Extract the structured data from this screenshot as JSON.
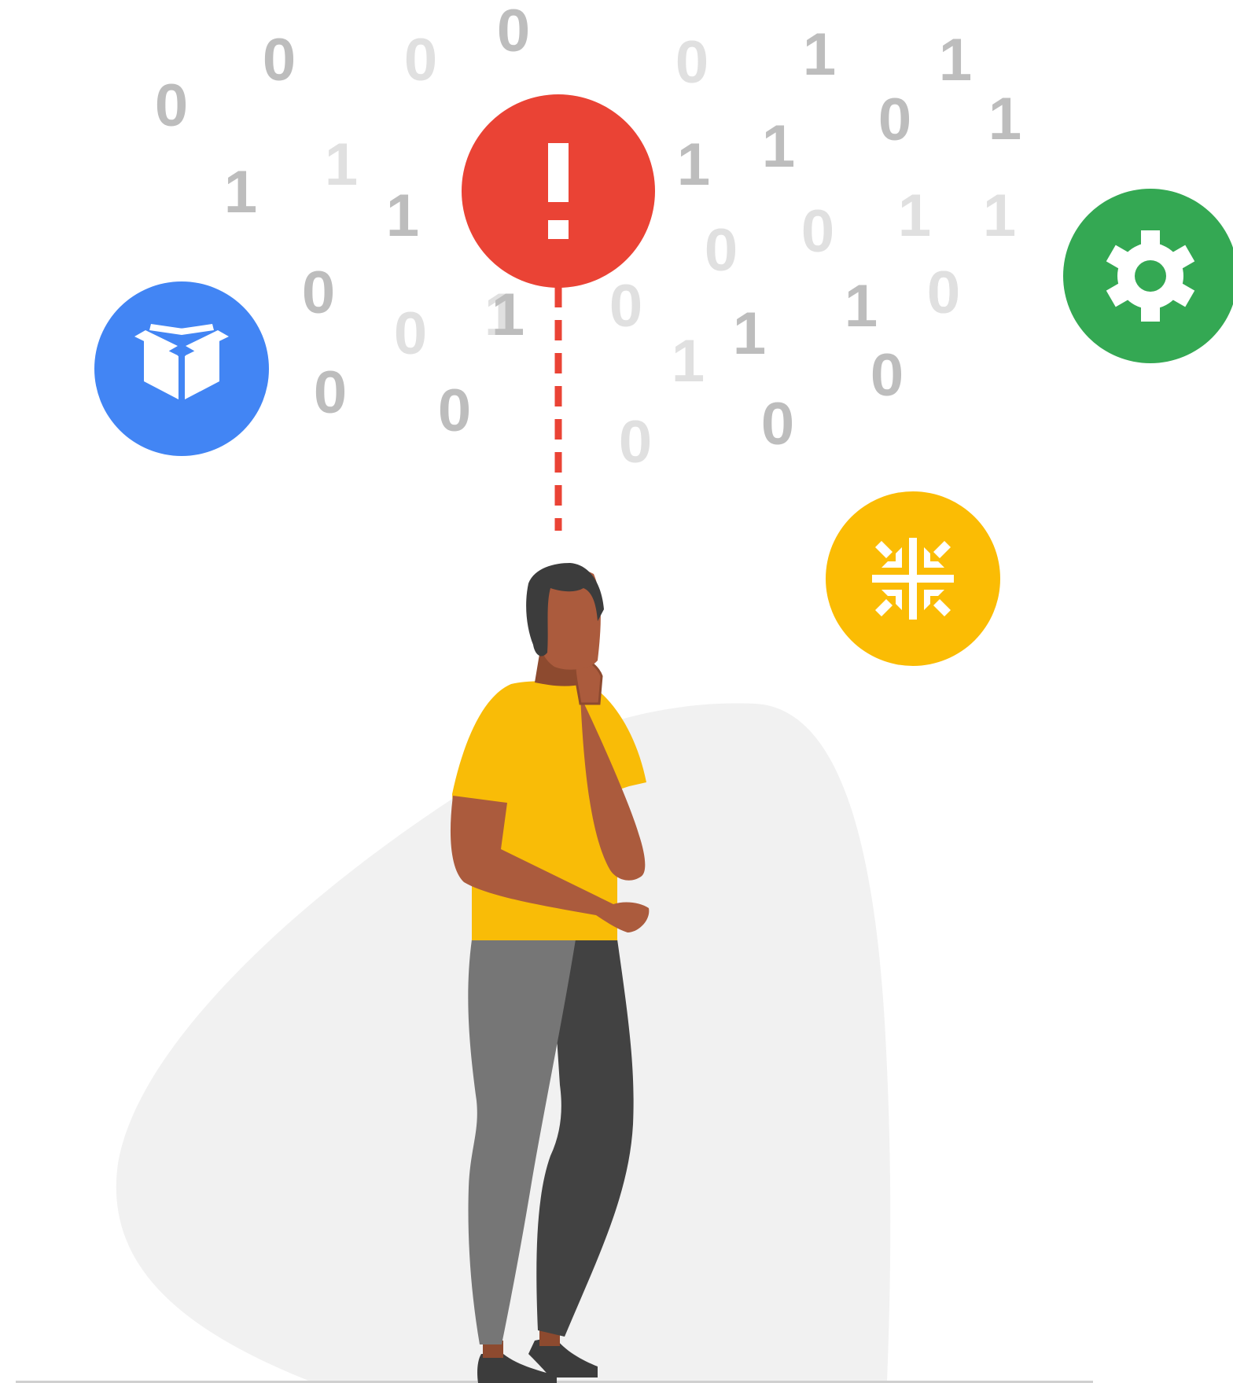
{
  "digits": [
    "0",
    "0",
    "0",
    "0",
    "0",
    "1",
    "1",
    "1",
    "1",
    "1",
    "0",
    "1",
    "1",
    "0",
    "1",
    "1",
    "0",
    "0",
    "1",
    "1",
    "0",
    "0",
    "1",
    "0",
    "0",
    "0",
    "1",
    "1",
    "0",
    "1",
    "0",
    "0",
    "0"
  ],
  "colors": {
    "alert_red": "#EA4335",
    "box_blue": "#4285F4",
    "settings_green": "#34A853",
    "compress_yellow": "#FBBC04",
    "shirt_yellow": "#F9BC07",
    "skin": "#AB5B3D",
    "hair": "#3C3C3C",
    "pants_light": "#767676",
    "pants_dark": "#424242",
    "backdrop_grey": "#F1F1F1",
    "digit_dark": "#BDBDBD",
    "digit_light": "#E0E0E0"
  },
  "icons": {
    "alert": "exclamation-icon",
    "box": "open-box-icon",
    "settings": "gear-icon",
    "compress": "compress-arrows-icon"
  }
}
